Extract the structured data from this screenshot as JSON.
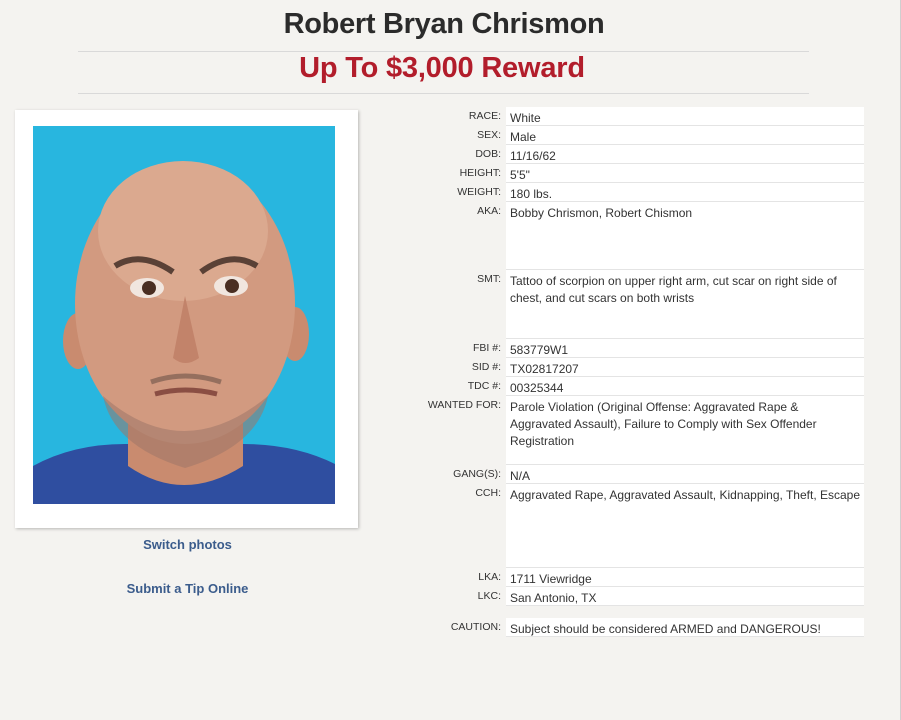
{
  "header": {
    "name": "Robert Bryan Chrismon",
    "reward": "Up To $3,000 Reward"
  },
  "links": {
    "switch_photos": "Switch photos",
    "submit_tip": "Submit a Tip Online"
  },
  "photo": {
    "background_color": "#28b6df",
    "icon": "mugshot-photo"
  },
  "details": {
    "race": {
      "label": "RACE:",
      "value": "White"
    },
    "sex": {
      "label": "SEX:",
      "value": "Male"
    },
    "dob": {
      "label": "DOB:",
      "value": "11/16/62"
    },
    "height": {
      "label": "HEIGHT:",
      "value": "5'5\""
    },
    "weight": {
      "label": "WEIGHT:",
      "value": "180 lbs."
    },
    "aka": {
      "label": "AKA:",
      "value": "Bobby Chrismon, Robert Chismon"
    },
    "smt": {
      "label": "SMT:",
      "value": "Tattoo of scorpion on upper right arm, cut scar on right side of chest, and cut scars on both wrists"
    },
    "fbi": {
      "label": "FBI #:",
      "value": "583779W1"
    },
    "sid": {
      "label": "SID #:",
      "value": "TX02817207"
    },
    "tdc": {
      "label": "TDC #:",
      "value": "00325344"
    },
    "wanted": {
      "label": "WANTED FOR:",
      "value": "Parole Violation (Original Offense: Aggravated Rape & Aggravated Assault), Failure to Comply with Sex Offender Registration"
    },
    "gangs": {
      "label": "GANG(S):",
      "value": "N/A"
    },
    "cch": {
      "label": "CCH:",
      "value": "Aggravated Rape, Aggravated Assault, Kidnapping, Theft, Escape"
    },
    "lka": {
      "label": "LKA:",
      "value": "1711 Viewridge"
    },
    "lkc": {
      "label": "LKC:",
      "value": "San Antonio, TX"
    },
    "caution": {
      "label": "CAUTION:",
      "value": "Subject should be considered ARMED and DANGEROUS!"
    }
  },
  "colors": {
    "reward_red": "#b21d2b",
    "link_blue": "#3b5c8c",
    "page_bg": "#f4f3f0"
  }
}
